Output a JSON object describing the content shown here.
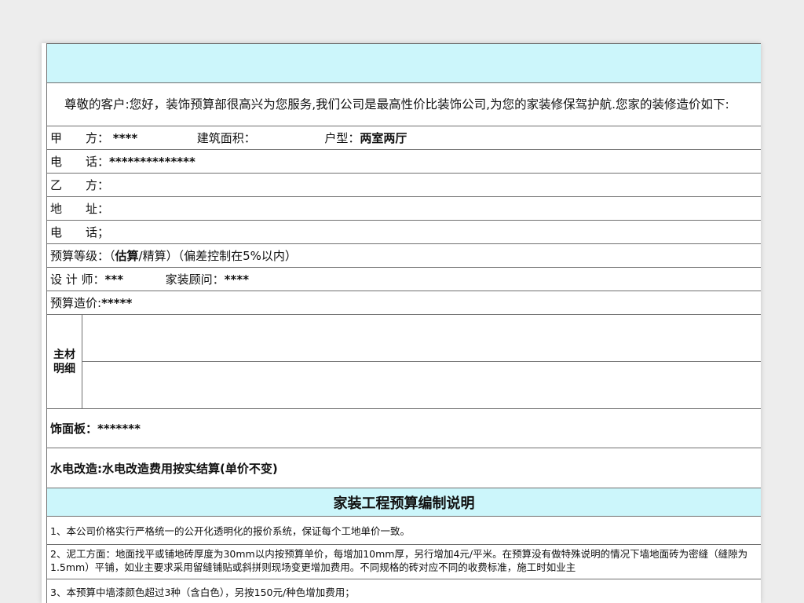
{
  "greeting": "尊敬的客户:您好，装饰预算部很高兴为您服务,我们公司是最高性价比装饰公司,为您的家装修保驾护航.您家的装修造价如下:",
  "party_a": {
    "label": "甲　　方：",
    "value": "****",
    "area_label": "建筑面积：",
    "layout_label": "户型：",
    "layout_value": "两室两厅"
  },
  "phone_a": {
    "label": "电　　话：",
    "value": "**************"
  },
  "party_b": {
    "label": "乙　　方："
  },
  "address": {
    "label": "地　　址："
  },
  "phone_b": {
    "label": "电　　话；"
  },
  "budget_level": {
    "label": "预算等级：（",
    "est": "估算",
    "rest": "/精算）（偏差控制在5%以内）"
  },
  "designer": {
    "label": "设 计 师：",
    "value": "***",
    "consultant_label": "家装顾问：",
    "consultant_value": "****"
  },
  "budget_cost": {
    "label": "预算造价:",
    "value": "*****"
  },
  "main_material": "主材明细",
  "panel": {
    "label": "饰面板：",
    "value": "*******"
  },
  "plumbing": "水电改造:水电改造费用按实结算(单价不变)",
  "section_title": "家装工程预算编制说明",
  "notes": [
    "1、本公司价格实行严格统一的公开化透明化的报价系统，保证每个工地单价一致。",
    "2、泥工方面：地面找平或铺地砖厚度为30mm以内按预算单价，每增加10mm厚，另行增加4元/平米。在预算没有做特殊说明的情况下墙地面砖为密缝（缝隙为1.5mm）平铺，如业主要求采用留缝铺贴或斜拼则现场变更增加费用。不同规格的砖对应不同的收费标准，施工时如业主",
    "3、本预算中墙漆颜色超过3种（含白色），另按150元/种色增加费用；"
  ]
}
